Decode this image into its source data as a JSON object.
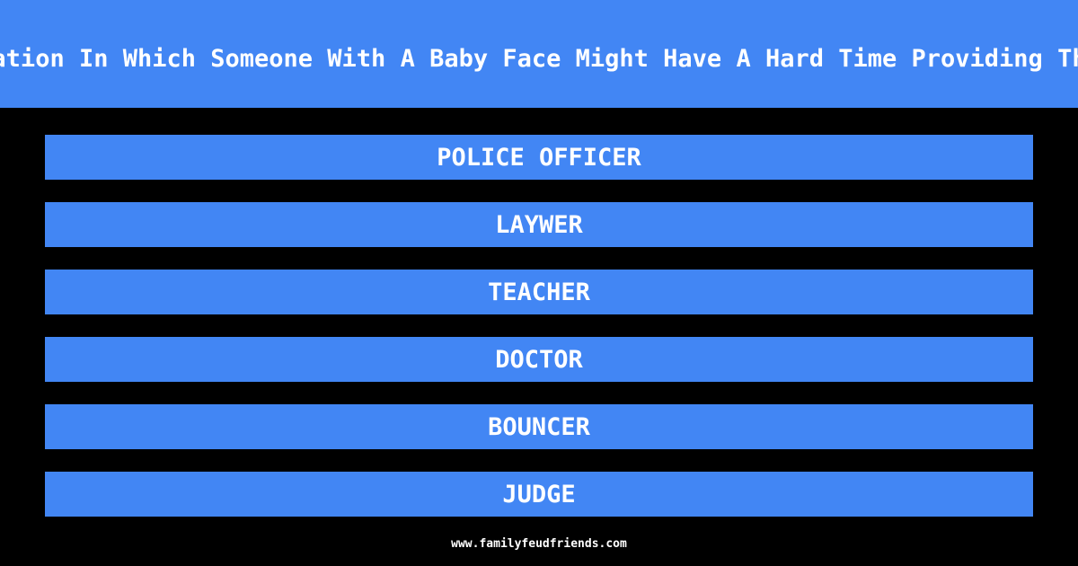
{
  "question": "Name An Occupation In Which Someone With A Baby Face Might Have A Hard Time Providing The Proper Authority",
  "visible_question_fragment": "ation In Which Someone With A Baby Face Might Have A Hard Time Providing Th",
  "answers": [
    {
      "label": "POLICE OFFICER"
    },
    {
      "label": "LAYWER"
    },
    {
      "label": "TEACHER"
    },
    {
      "label": "DOCTOR"
    },
    {
      "label": "BOUNCER"
    },
    {
      "label": "JUDGE"
    }
  ],
  "footer": {
    "url": "www.familyfeudfriends.com"
  },
  "colors": {
    "accent": "#4286f4",
    "background": "#000000",
    "text": "#ffffff"
  }
}
